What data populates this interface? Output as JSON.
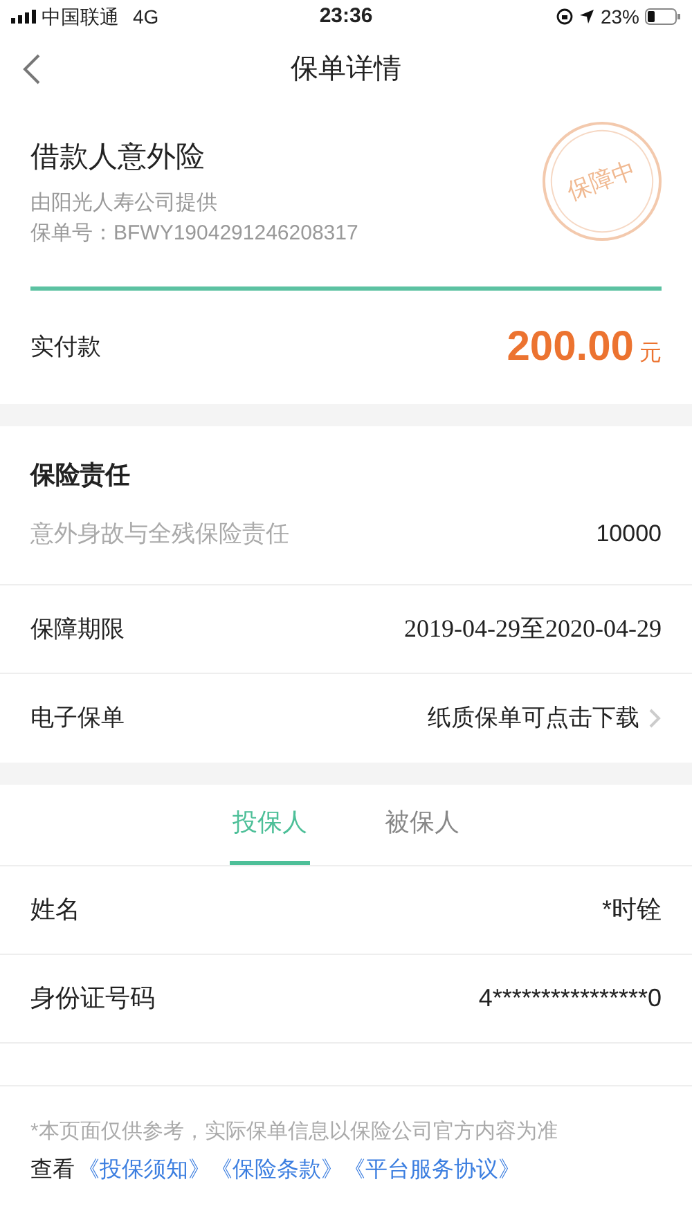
{
  "status_bar": {
    "carrier": "中国联通",
    "network": "4G",
    "time": "23:36",
    "battery": "23%"
  },
  "nav": {
    "title": "保单详情"
  },
  "policy": {
    "name": "借款人意外险",
    "provider": "由阳光人寿公司提供",
    "number": "保单号：BFWY1904291246208317",
    "stamp": "保障中"
  },
  "payment": {
    "label": "实付款",
    "amount": "200.00",
    "unit": "元"
  },
  "coverage": {
    "title": "保险责任",
    "items": [
      {
        "label": "意外身故与全残保险责任",
        "value": "10000"
      }
    ]
  },
  "rows": [
    {
      "label": "保障期限",
      "value": "2019-04-29至2020-04-29",
      "kind": "serif"
    },
    {
      "label": "电子保单",
      "value": "纸质保单可点击下载",
      "kind": "link"
    }
  ],
  "tabs": [
    {
      "label": "投保人",
      "selected": true
    },
    {
      "label": "被保人",
      "selected": false
    }
  ],
  "person_rows": [
    {
      "label": "姓名",
      "value": "*时铨"
    },
    {
      "label": "身份证号码",
      "value": "4****************0"
    }
  ],
  "footer": {
    "note": "*本页面仅供参考，实际保单信息以保险公司官方内容为准",
    "prefix": "查看",
    "links": [
      "《投保须知》",
      "《保险条款》",
      "《平台服务协议》"
    ]
  }
}
